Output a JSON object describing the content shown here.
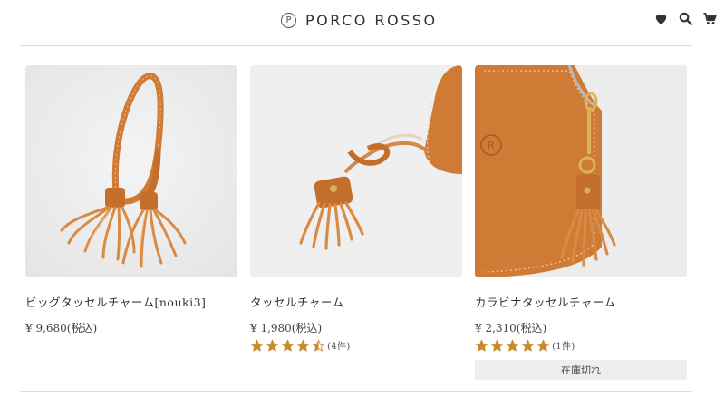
{
  "brand": {
    "mark": "P",
    "name": "PORCO ROSSO"
  },
  "header_icons": [
    "heart-icon",
    "search-icon",
    "cart-icon"
  ],
  "colors": {
    "star": "#c98a2a",
    "leather": "#cf7a35",
    "sold_out_bg": "#eeeeee"
  },
  "products": [
    {
      "name": "ビッグタッセルチャーム[nouki3]",
      "price": "¥ 9,680(税込)",
      "rating": null,
      "reviews": null,
      "sold_out": null
    },
    {
      "name": "タッセルチャーム",
      "price": "¥ 1,980(税込)",
      "rating": 4.5,
      "reviews": "(4件)",
      "sold_out": null
    },
    {
      "name": "カラビナタッセルチャーム",
      "price": "¥ 2,310(税込)",
      "rating": 5,
      "reviews": "(1件)",
      "sold_out": "在庫切れ"
    }
  ]
}
